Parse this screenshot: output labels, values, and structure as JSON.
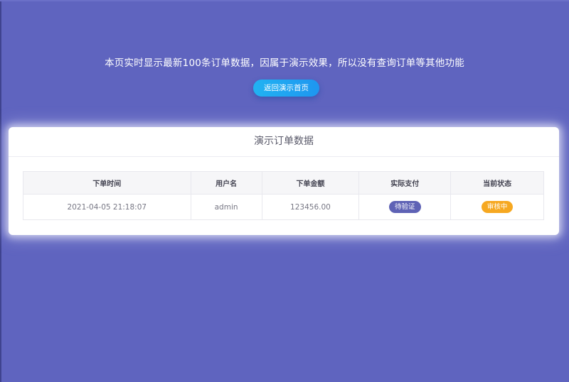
{
  "banner": {
    "notice": "本页实时显示最新100条订单数据，因属于演示效果，所以没有查询订单等其他功能",
    "home_button_label": "返回演示首页"
  },
  "card": {
    "title": "演示订单数据"
  },
  "table": {
    "columns": [
      "下单时间",
      "用户名",
      "下单金额",
      "实际支付",
      "当前状态"
    ],
    "rows": [
      {
        "order_time": "2021-04-05 21:18:07",
        "username": "admin",
        "amount": "123456.00",
        "payment_badge": "待验证",
        "status_badge": "审核中"
      }
    ]
  },
  "colors": {
    "background": "#5f64bf",
    "button": "#1ea6f1",
    "payment_badge": "#5e62b5",
    "status_badge": "#f6a821"
  }
}
